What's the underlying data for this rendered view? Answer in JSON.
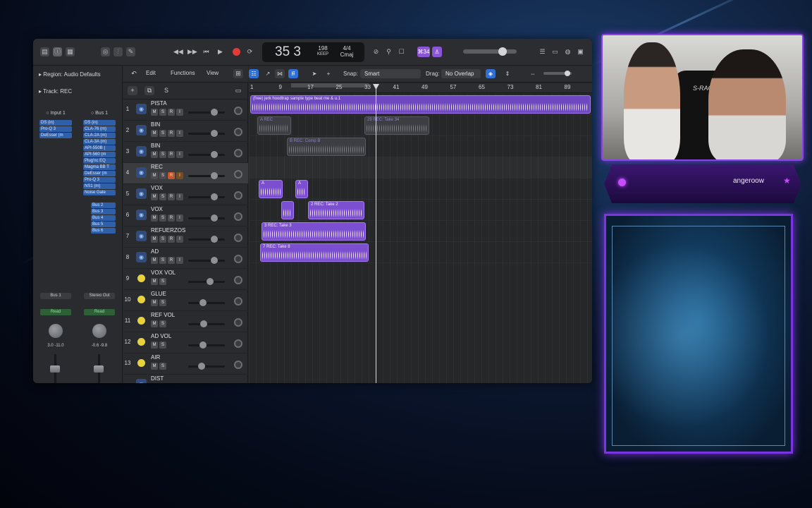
{
  "transport": {
    "bar": "35",
    "beat": "3",
    "tempo": "198",
    "tempo_label": "KEEP",
    "signature": "4/4",
    "key": "Cmaj",
    "count_badge": "⌘34"
  },
  "inspector": {
    "region_label": "Region:",
    "region_value": "Audio Defaults",
    "track_label": "Track:",
    "track_value": "REC",
    "strip1": {
      "input": "Input 1",
      "plugins": [
        "DS (in)",
        "Pro-Q 3",
        "DeEsser (m"
      ],
      "output": "Bus 1",
      "automation": "Read",
      "values": "3.0   -11.0"
    },
    "strip2": {
      "input": "Bus 1",
      "plugins": [
        "DS (in)",
        "CLA-76 (m)",
        "CLA-2A (m)",
        "CLA-3A (m)",
        "API-550B (",
        "API-560 (m",
        "Plug'nc EQ",
        "Magma BB T",
        "DeEsser (m",
        "Pro-Q 3",
        "NS1 (m)",
        "Noise Gate"
      ],
      "sends": [
        "Bus 2",
        "Bus 3",
        "Bus 4",
        "Bus 5",
        "Bus 6"
      ],
      "output": "Stereo Out",
      "automation": "Read",
      "values": "-0.6   -9.8"
    }
  },
  "toolbar": {
    "edit": "Edit",
    "functions": "Functions",
    "view": "View",
    "snap_label": "Snap:",
    "snap_value": "Smart",
    "drag_label": "Drag:",
    "drag_value": "No Overlap"
  },
  "ruler": [
    "1",
    "9",
    "17",
    "25",
    "33",
    "41",
    "49",
    "57",
    "65",
    "73",
    "81",
    "89"
  ],
  "tracks": [
    {
      "num": "1",
      "name": "PISTA"
    },
    {
      "num": "2",
      "name": "BIN"
    },
    {
      "num": "3",
      "name": "BIN"
    },
    {
      "num": "4",
      "name": "REC"
    },
    {
      "num": "5",
      "name": "VOX"
    },
    {
      "num": "6",
      "name": "VOX"
    },
    {
      "num": "7",
      "name": "REFUERZOS"
    },
    {
      "num": "8",
      "name": "AD"
    },
    {
      "num": "9",
      "name": "VOX VOL"
    },
    {
      "num": "10",
      "name": "GLUE"
    },
    {
      "num": "11",
      "name": "REF VOL"
    },
    {
      "num": "12",
      "name": "AD VOL"
    },
    {
      "num": "13",
      "name": "AIR"
    },
    {
      "num": "",
      "name": "DIST"
    }
  ],
  "regions": {
    "pista": "(free) jerk hoodtrap sample type beat me & u.1",
    "bin1": "A  REC",
    "bin1b": "29  REC: Take 34",
    "bin2": "B  REC: Comp B",
    "vox1a": "A",
    "vox1b": "A",
    "vox2a": "",
    "vox2b": "2  REC: Take 2",
    "refuerzos": "3  REC: Take 3",
    "ad": "7  REC: Take 8"
  },
  "overlay": {
    "chair_brand": "S-RACE",
    "username": "angeroow"
  },
  "colors": {
    "accent_purple": "#8a55d6",
    "region_purple": "#7b4fd0",
    "record_red": "#e33b3b",
    "track_yellow": "#e8d23c"
  }
}
